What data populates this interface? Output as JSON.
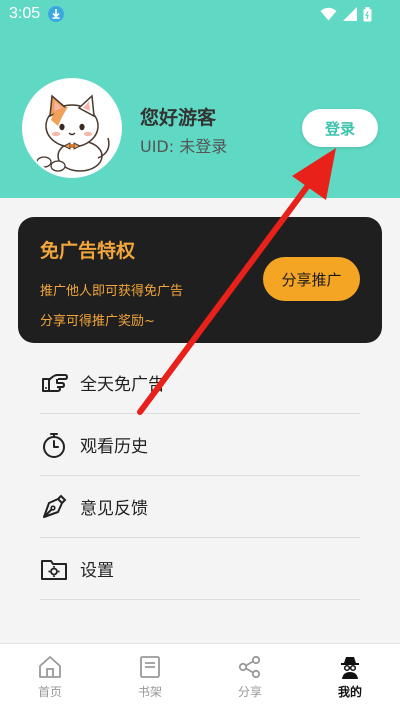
{
  "status": {
    "time": "3:05"
  },
  "profile": {
    "greeting": "您好游客",
    "uid": "UID: 未登录",
    "login_label": "登录",
    "avatar_icon": "cat-avatar-icon"
  },
  "promo": {
    "title": "免广告特权",
    "line1": "推广他人即可获得免广告",
    "line2": "分享可得推广奖励~",
    "share_label": "分享推广",
    "accent": "#f3a63a"
  },
  "menu": {
    "items": [
      {
        "label": "全天免广告",
        "icon": "hand-point-icon"
      },
      {
        "label": "观看历史",
        "icon": "stopwatch-icon"
      },
      {
        "label": "意见反馈",
        "icon": "pen-nib-icon"
      },
      {
        "label": "设置",
        "icon": "settings-folder-icon"
      }
    ]
  },
  "tabs": [
    {
      "label": "首页",
      "icon": "home-icon"
    },
    {
      "label": "书架",
      "icon": "book-icon"
    },
    {
      "label": "分享",
      "icon": "share-icon"
    },
    {
      "label": "我的",
      "icon": "user-spy-icon",
      "active": true
    }
  ],
  "colors": {
    "header": "#5fd9c4",
    "annotation_arrow": "#e8211b"
  }
}
